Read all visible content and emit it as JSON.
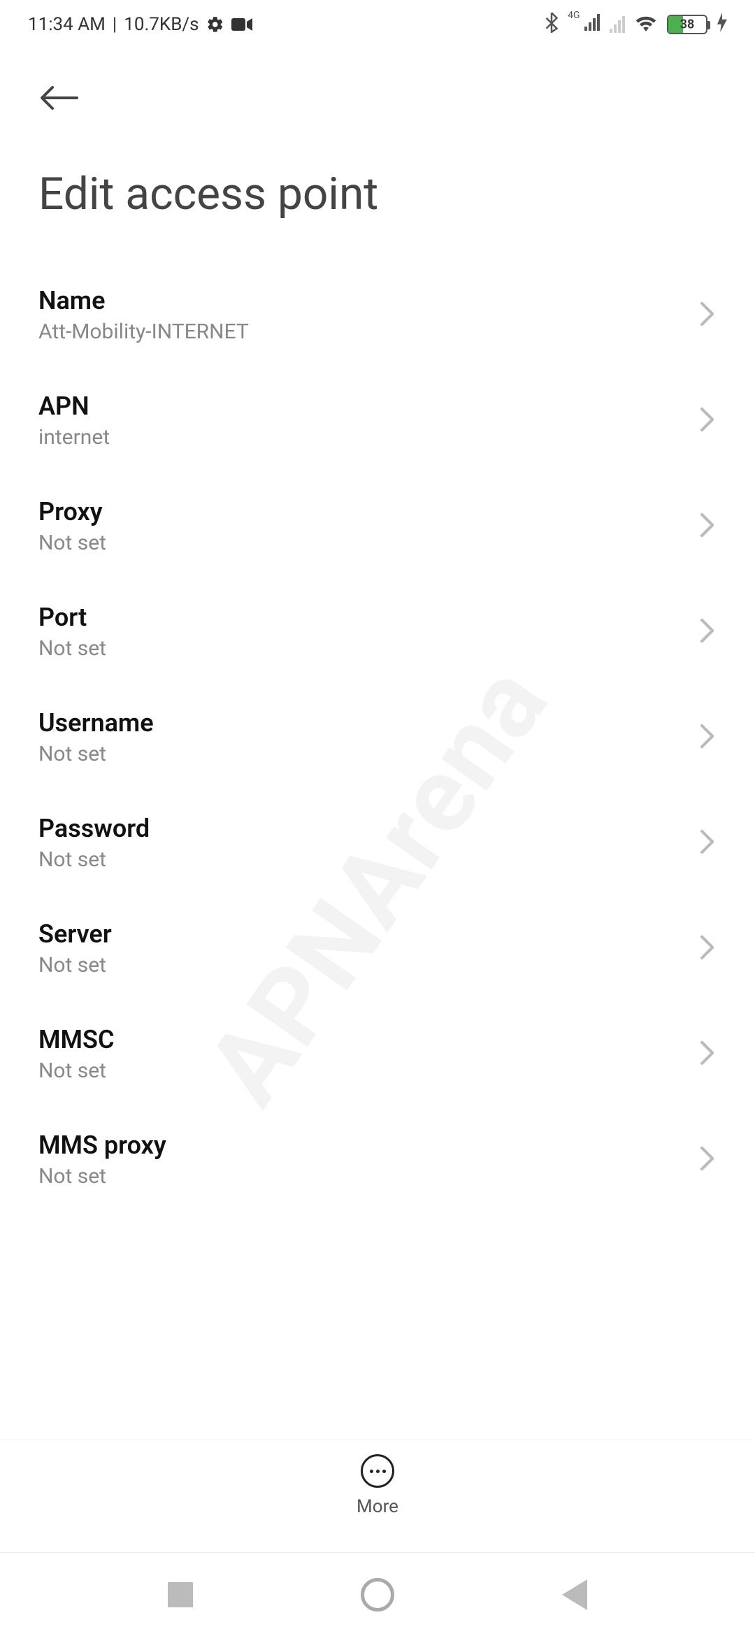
{
  "status_bar": {
    "time": "11:34 AM",
    "separator": "|",
    "data_rate": "10.7KB/s",
    "network_label": "4G",
    "battery_percent": "38"
  },
  "header": {
    "title": "Edit access point"
  },
  "settings": [
    {
      "label": "Name",
      "value": "Att-Mobility-INTERNET"
    },
    {
      "label": "APN",
      "value": "internet"
    },
    {
      "label": "Proxy",
      "value": "Not set"
    },
    {
      "label": "Port",
      "value": "Not set"
    },
    {
      "label": "Username",
      "value": "Not set"
    },
    {
      "label": "Password",
      "value": "Not set"
    },
    {
      "label": "Server",
      "value": "Not set"
    },
    {
      "label": "MMSC",
      "value": "Not set"
    },
    {
      "label": "MMS proxy",
      "value": "Not set"
    }
  ],
  "bottom_action": {
    "label": "More"
  },
  "watermark": "APNArena"
}
